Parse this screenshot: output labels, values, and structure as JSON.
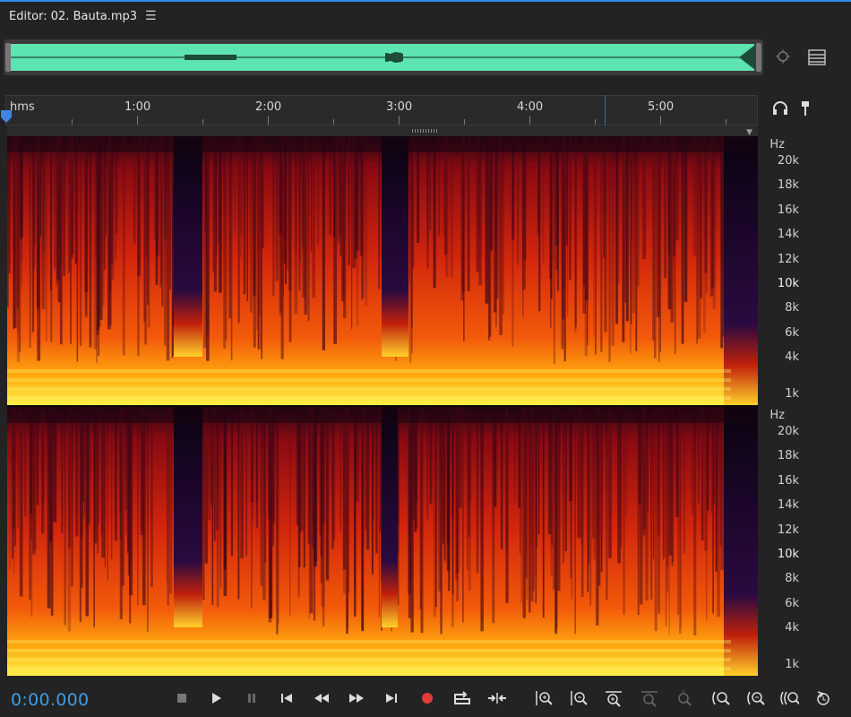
{
  "window": {
    "title": "Editor: 02. Bauta.mp3",
    "menu_icon": "hamburger-menu-icon",
    "accent_color": "#2d8ceb"
  },
  "overview": {
    "waveform_color": "#5de4b0",
    "icons": [
      "zoom-to-selection-icon",
      "list-view-icon"
    ]
  },
  "ruler": {
    "unit": "hms",
    "labels": [
      "1:00",
      "2:00",
      "3:00",
      "4:00",
      "5:00"
    ],
    "icons": [
      "headphones-icon",
      "marker-pin-icon"
    ]
  },
  "spectral": {
    "channels": [
      {
        "axis_unit": "Hz",
        "ticks": [
          "20k",
          "18k",
          "16k",
          "14k",
          "12k",
          "10k",
          "8k",
          "6k",
          "4k",
          "1k"
        ]
      },
      {
        "axis_unit": "Hz",
        "ticks": [
          "20k",
          "18k",
          "16k",
          "14k",
          "12k",
          "10k",
          "8k",
          "6k",
          "4k",
          "1k"
        ]
      }
    ]
  },
  "transport": {
    "timecode": "0:00.000",
    "timecode_color": "#3f9ae8",
    "record_color": "#e23b3b",
    "buttons": [
      "stop-icon",
      "play-icon",
      "pause-icon",
      "go-to-start-icon",
      "rewind-icon",
      "fast-forward-icon",
      "go-to-end-icon",
      "record-icon",
      "loop-playback-icon",
      "skip-selection-icon"
    ],
    "zoom_buttons": [
      "zoom-in-amplitude-icon",
      "zoom-out-amplitude-icon",
      "zoom-in-time-icon",
      "zoom-out-full-icon",
      "zoom-to-selection-icon",
      "zoom-in-left-icon",
      "zoom-in-right-icon",
      "zoom-out-selection-icon",
      "zoom-reset-icon"
    ]
  }
}
